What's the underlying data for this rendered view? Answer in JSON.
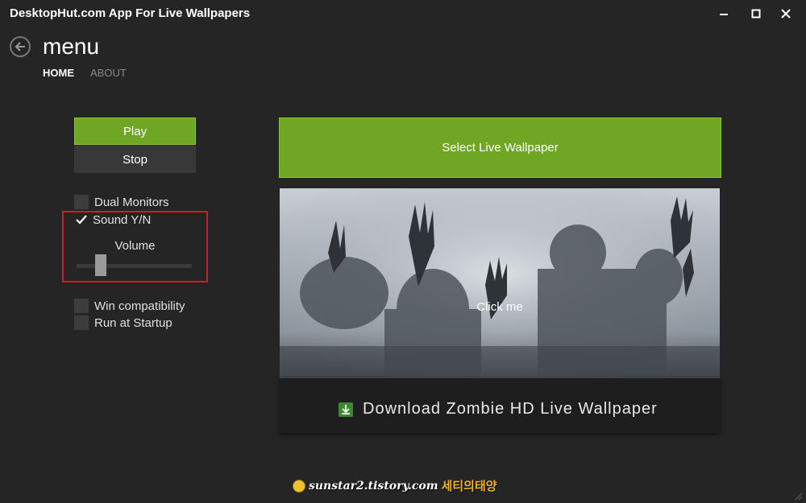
{
  "window": {
    "title": "DesktopHut.com App For Live Wallpapers",
    "controls": [
      "minimize-icon",
      "maximize-icon",
      "close-icon"
    ]
  },
  "header": {
    "back_icon": "back-arrow-icon",
    "title": "menu",
    "tabs": [
      {
        "label": "HOME",
        "active": true
      },
      {
        "label": "ABOUT",
        "active": false
      }
    ]
  },
  "controls": {
    "play_label": "Play",
    "stop_label": "Stop",
    "options": [
      {
        "label": "Dual Monitors",
        "checked": false
      },
      {
        "label": "Sound Y/N",
        "checked": true
      },
      {
        "label": "Win compatibility",
        "checked": false
      },
      {
        "label": "Run at Startup",
        "checked": false
      }
    ],
    "volume": {
      "label": "Volume",
      "level": 0.2
    }
  },
  "main": {
    "select_label": "Select Live Wallpaper",
    "preview_label": "Click me",
    "download_label": "Download Zombie HD Live Wallpaper",
    "download_icon": "download-icon"
  },
  "watermark": {
    "text": "sunstar2.tistory.com",
    "korean": "세티의태양",
    "icon": "smiley-icon"
  },
  "colors": {
    "accent_green": "#6fa623",
    "background": "#252525",
    "highlight_red": "#d21d1d"
  }
}
